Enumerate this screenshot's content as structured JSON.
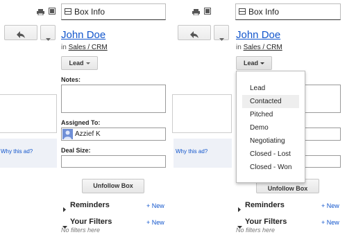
{
  "panels": [
    {
      "header_title": "Box Info",
      "contact_name": "John Doe",
      "in_prefix": "in",
      "pipeline": "Sales / CRM",
      "stage_label": "Lead",
      "notes_label": "Notes:",
      "assigned_label": "Assigned To:",
      "assignee": "Azzief K",
      "deal_label": "Deal Size:",
      "unfollow_label": "Unfollow Box",
      "reminders_label": "Reminders",
      "reminders_new": "+ New",
      "filters_label": "Your Filters",
      "filters_new": "+ New",
      "no_filters": "No filters here",
      "ad_link": "Why this ad?"
    },
    {
      "header_title": "Box Info",
      "contact_name": "John Doe",
      "in_prefix": "in",
      "pipeline": "Sales / CRM",
      "stage_label": "Lead",
      "unfollow_label": "Unfollow Box",
      "reminders_label": "Reminders",
      "reminders_new": "+ New",
      "filters_label": "Your Filters",
      "filters_new": "+ New",
      "no_filters": "No filters here",
      "ad_link": "Why this ad?"
    }
  ],
  "stage_menu": {
    "items": [
      "Lead",
      "Contacted",
      "Pitched",
      "Demo",
      "Negotiating",
      "Closed - Lost",
      "Closed - Won"
    ],
    "highlighted": "Contacted"
  },
  "icons": [
    "print-icon",
    "new-window-icon",
    "reply-icon",
    "more-dropdown-icon",
    "box-icon",
    "avatar",
    "expand-arrow-icon"
  ],
  "colors": {
    "link": "#1155cc",
    "menu_highlight": "#eeeeee"
  }
}
